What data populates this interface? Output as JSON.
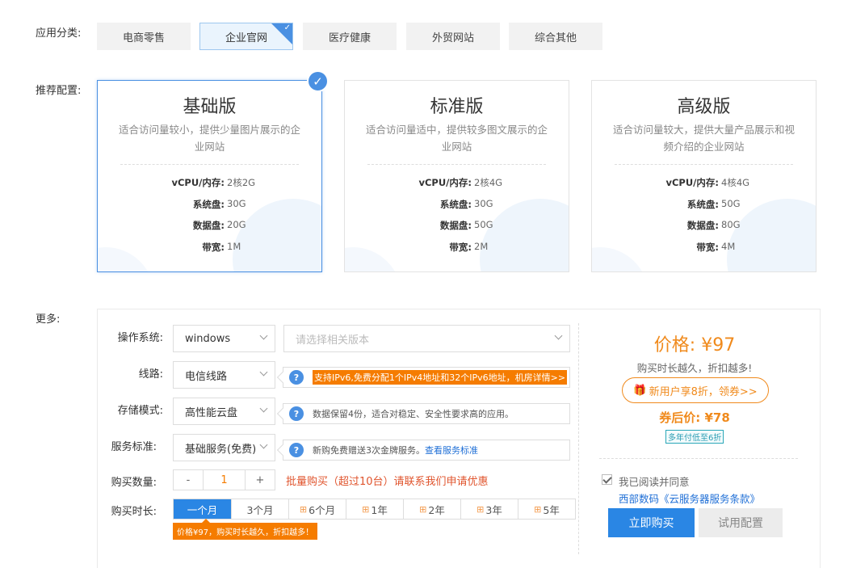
{
  "category": {
    "label": "应用分类:",
    "items": [
      "电商零售",
      "企业官网",
      "医疗健康",
      "外贸网站",
      "综合其他"
    ],
    "selected_index": 1
  },
  "plans": {
    "label": "推荐配置:",
    "selected_index": 0,
    "items": [
      {
        "title": "基础版",
        "desc": "适合访问量较小，提供少量图片展示的企业网站",
        "specs": [
          {
            "k": "vCPU/内存:",
            "v": "2核2G"
          },
          {
            "k": "系统盘:",
            "v": "30G"
          },
          {
            "k": "数据盘:",
            "v": "20G"
          },
          {
            "k": "带宽:",
            "v": "1M"
          }
        ]
      },
      {
        "title": "标准版",
        "desc": "适合访问量适中，提供较多图文展示的企业网站",
        "specs": [
          {
            "k": "vCPU/内存:",
            "v": "2核4G"
          },
          {
            "k": "系统盘:",
            "v": "30G"
          },
          {
            "k": "数据盘:",
            "v": "50G"
          },
          {
            "k": "带宽:",
            "v": "2M"
          }
        ]
      },
      {
        "title": "高级版",
        "desc": "适合访问量较大，提供大量产品展示和视频介绍的企业网站",
        "specs": [
          {
            "k": "vCPU/内存:",
            "v": "4核4G"
          },
          {
            "k": "系统盘:",
            "v": "50G"
          },
          {
            "k": "数据盘:",
            "v": "80G"
          },
          {
            "k": "带宽:",
            "v": "4M"
          }
        ]
      }
    ]
  },
  "more": {
    "label": "更多:",
    "os": {
      "label": "操作系统:",
      "value": "windows",
      "version_placeholder": "请选择相关版本"
    },
    "line": {
      "label": "线路:",
      "value": "电信线路",
      "tip": "支持IPv6,免费分配1个IPv4地址和32个IPv6地址，机房详情>>"
    },
    "storage": {
      "label": "存储模式:",
      "value": "高性能云盘",
      "tip": "数据保留4份，适合对稳定、安全性要求高的应用。"
    },
    "service": {
      "label": "服务标准:",
      "value": "基础服务(免费)",
      "tip": "新购免费赠送3次金牌服务。",
      "tip_link": "查看服务标准"
    },
    "qty": {
      "label": "购买数量:",
      "minus": "-",
      "value": "1",
      "plus": "+",
      "bulk": "批量购买（超过10台）请联系我们申请优惠"
    },
    "duration": {
      "label": "购买时长:",
      "options": [
        "一个月",
        "3个月",
        "6个月",
        "1年",
        "2年",
        "3年",
        "5年"
      ],
      "selected_index": 0,
      "tip": "价格¥97，购买时长越久，折扣越多！"
    }
  },
  "summary": {
    "price": "价格: ¥97",
    "slogan": "购买时长越久，折扣越多!",
    "coupon": "新用户享8折，领券>>",
    "after_coupon": "券后价: ¥78",
    "badge": "多年付低至6折",
    "agree_text": "我已阅读并同意",
    "terms": "西部数码《云服务器服务条款》",
    "buy": "立即购买",
    "trial": "试用配置"
  },
  "colors": {
    "accent": "#2a86e4",
    "orange": "#f57c00",
    "price": "#f08a1c"
  }
}
